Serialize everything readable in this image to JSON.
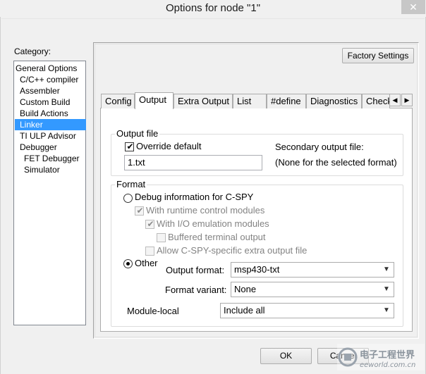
{
  "window": {
    "title": "Options for node \"1\"",
    "close_glyph": "✕"
  },
  "category": {
    "label": "Category:",
    "items": [
      {
        "label": "General Options",
        "indent": 0,
        "selected": false
      },
      {
        "label": "C/C++ compiler",
        "indent": 1,
        "selected": false
      },
      {
        "label": "Assembler",
        "indent": 1,
        "selected": false
      },
      {
        "label": "Custom Build",
        "indent": 1,
        "selected": false
      },
      {
        "label": "Build Actions",
        "indent": 1,
        "selected": false
      },
      {
        "label": "Linker",
        "indent": 1,
        "selected": true
      },
      {
        "label": "TI ULP Advisor",
        "indent": 1,
        "selected": false
      },
      {
        "label": "Debugger",
        "indent": 1,
        "selected": false
      },
      {
        "label": "FET Debugger",
        "indent": 2,
        "selected": false
      },
      {
        "label": "Simulator",
        "indent": 2,
        "selected": false
      }
    ]
  },
  "factory_settings_label": "Factory Settings",
  "tabs": [
    "Config",
    "Output",
    "Extra Output",
    "List",
    "#define",
    "Diagnostics",
    "Check"
  ],
  "active_tab": "Output",
  "tab_scroll": {
    "left": "◀",
    "right": "▶"
  },
  "output_file": {
    "group_title": "Output file",
    "override_label": "Override default",
    "override_checked": true,
    "filename": "1.txt",
    "secondary_label": "Secondary output file:",
    "secondary_value": "(None for the selected format)"
  },
  "format": {
    "group_title": "Format",
    "debug_label": "Debug information for C-SPY",
    "debug_selected": false,
    "runtime_label": "With runtime control modules",
    "io_label": "With I/O emulation modules",
    "buffered_label": "Buffered terminal output",
    "allow_label": "Allow C-SPY-specific extra output file",
    "other_label": "Other",
    "other_selected": true,
    "output_format_label": "Output format:",
    "output_format_value": "msp430-txt",
    "format_variant_label": "Format variant:",
    "format_variant_value": "None",
    "module_local_label": "Module-local",
    "module_local_value": "Include all"
  },
  "buttons": {
    "ok": "OK",
    "cancel": "Cancel"
  },
  "watermark": {
    "text": "电子工程世界",
    "sub": "eeworld.com.cn"
  },
  "colors": {
    "selection": "#3399ff",
    "dialog_bg": "#f0f0f0"
  }
}
